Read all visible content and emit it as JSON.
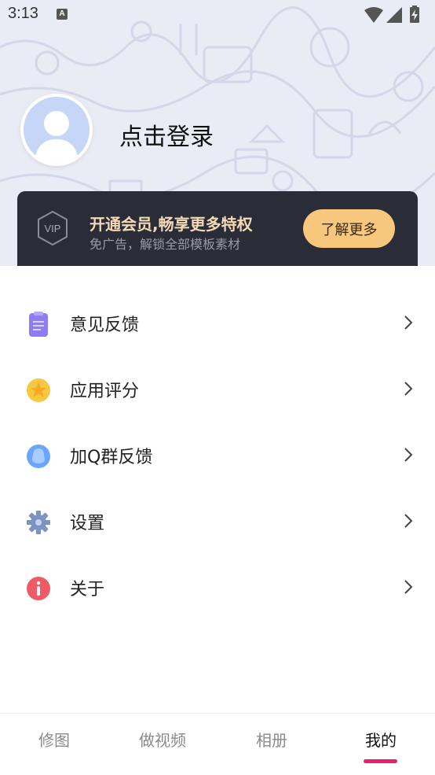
{
  "status_bar": {
    "time": "3:13",
    "notification_letter": "A",
    "icons": [
      "wifi-icon",
      "signal-icon",
      "battery-charging-icon"
    ]
  },
  "profile": {
    "login_label": "点击登录",
    "avatar_icon": "default-avatar-icon"
  },
  "vip": {
    "badge_text": "VIP",
    "title": "开通会员,畅享更多特权",
    "subtitle": "免广告，解锁全部模板素材",
    "button_label": "了解更多"
  },
  "menu": {
    "items": [
      {
        "label": "意见反馈",
        "icon": "clipboard-icon",
        "color": "#8f7cf2"
      },
      {
        "label": "应用评分",
        "icon": "star-icon",
        "color": "#f6c842"
      },
      {
        "label": "加Q群反馈",
        "icon": "qq-penguin-icon",
        "color": "#6aa6ff"
      },
      {
        "label": "设置",
        "icon": "gear-icon",
        "color": "#7d93c4"
      },
      {
        "label": "关于",
        "icon": "info-icon",
        "color": "#f05a64"
      }
    ]
  },
  "tabbar": {
    "tabs": [
      {
        "label": "修图",
        "active": false
      },
      {
        "label": "做视频",
        "active": false
      },
      {
        "label": "相册",
        "active": false
      },
      {
        "label": "我的",
        "active": true
      }
    ],
    "accent_color": "#ee1f6a"
  }
}
